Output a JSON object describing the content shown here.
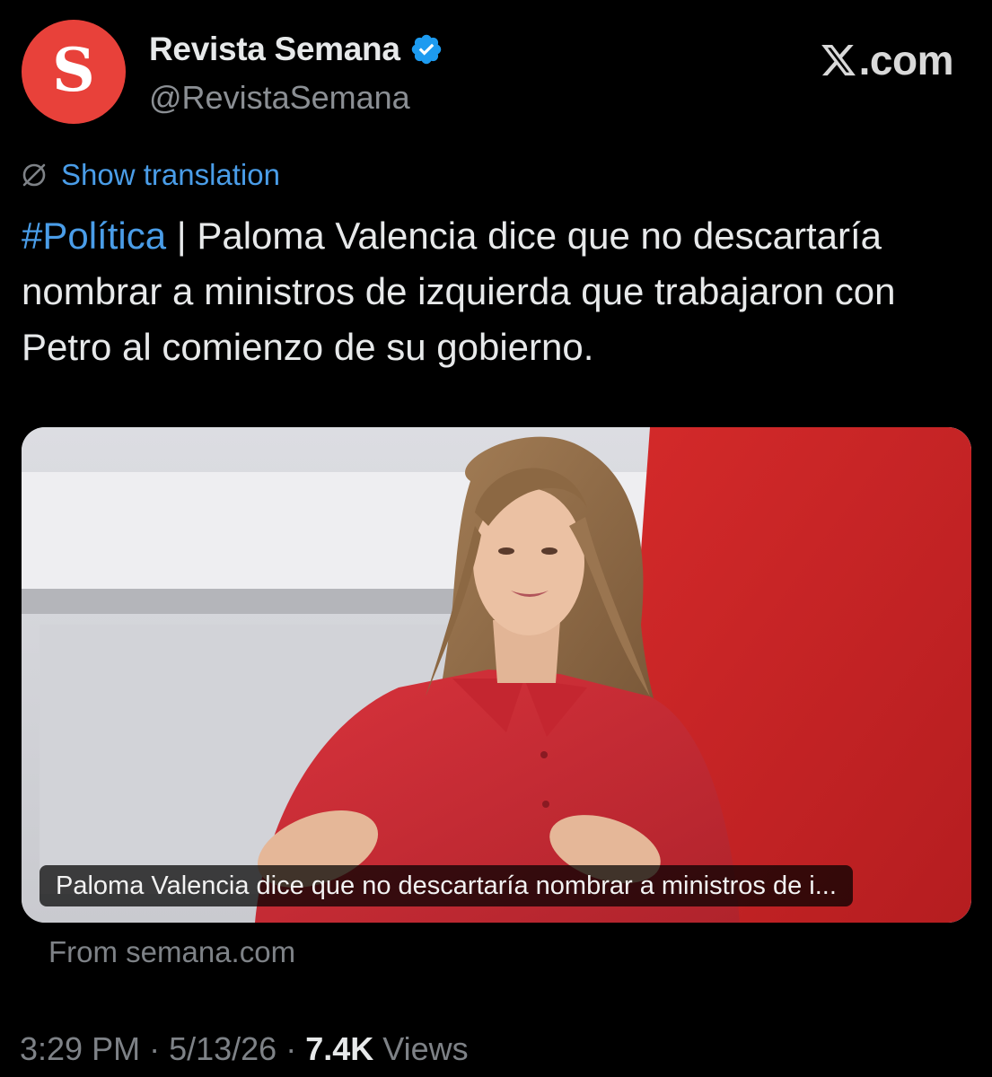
{
  "account": {
    "avatar_letter": "S",
    "display_name": "Revista Semana",
    "handle": "@RevistaSemana",
    "verified": true
  },
  "brand": {
    "source_label": ".com",
    "logo_icon": "x-logo-icon"
  },
  "translation": {
    "label": "Show translation",
    "icon": "globe-off-icon"
  },
  "tweet": {
    "hashtag": "#Política",
    "separator": " | ",
    "body": "Paloma Valencia dice que no descartaría nombrar a ministros de izquierda que trabajaron con Petro al comienzo de su gobierno."
  },
  "card": {
    "caption": "Paloma Valencia dice que no descartaría nombrar a ministros de i...",
    "source": "From semana.com"
  },
  "meta": {
    "time": "3:29 PM",
    "date": "5/13/26",
    "separator": "·",
    "views_count": "7.4K",
    "views_label": "Views"
  },
  "colors": {
    "background": "#000000",
    "text_primary": "#e7e9ea",
    "text_secondary": "#7e8287",
    "link": "#4a9de8",
    "verified_badge": "#1d9bf0",
    "avatar_bg": "#e8413a"
  }
}
